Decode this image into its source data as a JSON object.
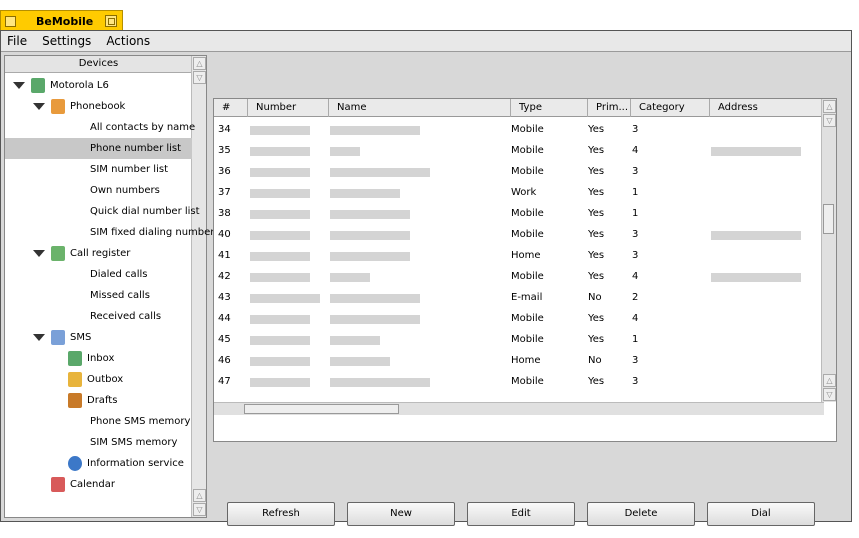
{
  "app": {
    "title": "BeMobile"
  },
  "menu": [
    "File",
    "Settings",
    "Actions"
  ],
  "sidebar": {
    "header": "Devices",
    "items": [
      {
        "label": "Motorola L6",
        "level": 0,
        "icon": "phone-icon",
        "expanded": true
      },
      {
        "label": "Phonebook",
        "level": 1,
        "icon": "contacts-icon",
        "expanded": true
      },
      {
        "label": "All contacts by name",
        "level": 2
      },
      {
        "label": "Phone number list",
        "level": 2,
        "selected": true
      },
      {
        "label": "SIM number list",
        "level": 2
      },
      {
        "label": "Own numbers",
        "level": 2
      },
      {
        "label": "Quick dial number list",
        "level": 2
      },
      {
        "label": "SIM fixed dialing number",
        "level": 2
      },
      {
        "label": "Call register",
        "level": 1,
        "icon": "call-register-icon",
        "expanded": true
      },
      {
        "label": "Dialed calls",
        "level": 2
      },
      {
        "label": "Missed calls",
        "level": 2
      },
      {
        "label": "Received calls",
        "level": 2
      },
      {
        "label": "SMS",
        "level": 1,
        "icon": "envelope-icon",
        "expanded": true
      },
      {
        "label": "Inbox",
        "level": 2,
        "icon": "inbox-icon"
      },
      {
        "label": "Outbox",
        "level": 2,
        "icon": "outbox-icon"
      },
      {
        "label": "Drafts",
        "level": 2,
        "icon": "drafts-icon"
      },
      {
        "label": "Phone SMS memory",
        "level": 2
      },
      {
        "label": "SIM SMS memory",
        "level": 2
      },
      {
        "label": "Information service",
        "level": 2,
        "icon": "info-icon"
      },
      {
        "label": "Calendar",
        "level": 1,
        "icon": "calendar-icon"
      }
    ]
  },
  "table": {
    "columns": [
      "#",
      "Number",
      "Name",
      "Type",
      "Prim...",
      "Category",
      "Address"
    ],
    "rows": [
      {
        "id": "34",
        "type": "Mobile",
        "primary": "Yes",
        "category": "3"
      },
      {
        "id": "35",
        "type": "Mobile",
        "primary": "Yes",
        "category": "4"
      },
      {
        "id": "36",
        "type": "Mobile",
        "primary": "Yes",
        "category": "3"
      },
      {
        "id": "37",
        "type": "Work",
        "primary": "Yes",
        "category": "1"
      },
      {
        "id": "38",
        "type": "Mobile",
        "primary": "Yes",
        "category": "1"
      },
      {
        "id": "40",
        "type": "Mobile",
        "primary": "Yes",
        "category": "3"
      },
      {
        "id": "41",
        "type": "Home",
        "primary": "Yes",
        "category": "3"
      },
      {
        "id": "42",
        "type": "Mobile",
        "primary": "Yes",
        "category": "4"
      },
      {
        "id": "43",
        "type": "E-mail",
        "primary": "No",
        "category": "2"
      },
      {
        "id": "44",
        "type": "Mobile",
        "primary": "Yes",
        "category": "4"
      },
      {
        "id": "45",
        "type": "Mobile",
        "primary": "Yes",
        "category": "1"
      },
      {
        "id": "46",
        "type": "Home",
        "primary": "No",
        "category": "3"
      },
      {
        "id": "47",
        "type": "Mobile",
        "primary": "Yes",
        "category": "3"
      }
    ]
  },
  "buttons": {
    "refresh": "Refresh",
    "new": "New",
    "edit": "Edit",
    "delete": "Delete",
    "dial": "Dial"
  },
  "colors": {
    "tab": "#ffcb00",
    "selection": "#c8c8c8",
    "panel": "#d8d8d8"
  }
}
